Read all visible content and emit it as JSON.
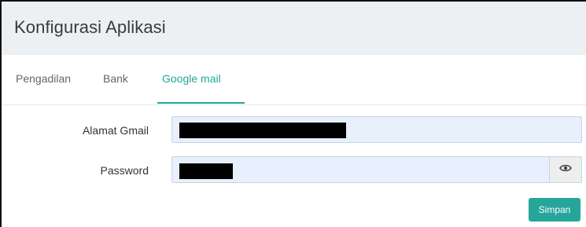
{
  "header": {
    "title": "Konfigurasi Aplikasi"
  },
  "tabs": [
    {
      "label": "Pengadilan",
      "active": false
    },
    {
      "label": "Bank",
      "active": false
    },
    {
      "label": "Google mail",
      "active": true
    }
  ],
  "form": {
    "gmail": {
      "label": "Alamat Gmail",
      "value": ""
    },
    "password": {
      "label": "Password",
      "value": "",
      "toggle_icon": "eye-icon"
    }
  },
  "actions": {
    "save_label": "Simpan"
  },
  "colors": {
    "accent": "#26a69a",
    "header_bg": "#edf0f3",
    "input_bg": "#e8f0fe"
  }
}
